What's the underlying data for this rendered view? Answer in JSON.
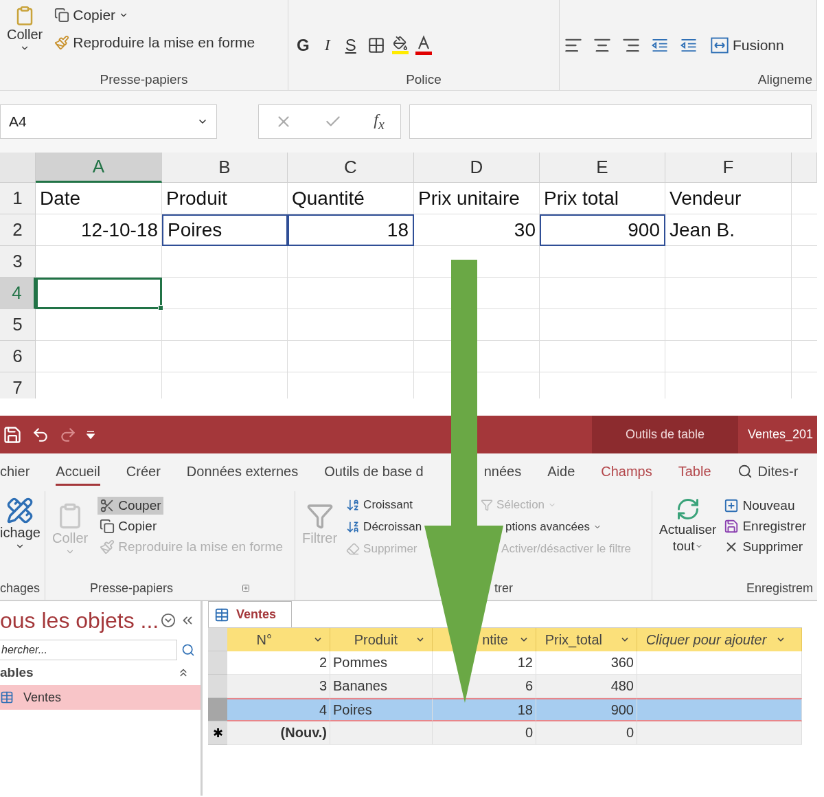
{
  "excel": {
    "ribbon": {
      "clipboard": {
        "label": "Presse-papiers",
        "paste": "Coller",
        "items": [
          {
            "kind": "copy",
            "label": "Copier"
          },
          {
            "kind": "format_painter",
            "label": "Reproduire la mise en forme"
          }
        ]
      },
      "font": {
        "label": "Police",
        "bold": "G",
        "italic": "I",
        "underline": "S"
      },
      "alignment": {
        "label": "Aligneme",
        "merge": "Fusionn"
      }
    },
    "formula_bar": {
      "name_box": "A4",
      "function": "f$_{x}$"
    },
    "columns": [
      "A",
      "B",
      "C",
      "D",
      "E",
      "F"
    ],
    "rows": [
      {
        "number": "1",
        "cells": [
          {
            "text": "Date",
            "kind": "text",
            "selected": false,
            "outlined": false
          },
          {
            "text": "Produit",
            "kind": "text",
            "selected": false,
            "outlined": false
          },
          {
            "text": "Quantité",
            "kind": "text",
            "selected": false,
            "outlined": false
          },
          {
            "text": "Prix unitaire",
            "kind": "text",
            "selected": false,
            "outlined": false
          },
          {
            "text": "Prix total",
            "kind": "text",
            "selected": false,
            "outlined": false
          },
          {
            "text": "Vendeur",
            "kind": "text",
            "selected": false,
            "outlined": false
          }
        ]
      },
      {
        "number": "2",
        "cells": [
          {
            "text": "12-10-18",
            "kind": "number",
            "selected": false,
            "outlined": false
          },
          {
            "text": "Poires",
            "kind": "text",
            "selected": false,
            "outlined": true
          },
          {
            "text": "18",
            "kind": "number",
            "selected": false,
            "outlined": true
          },
          {
            "text": "30",
            "kind": "number",
            "selected": false,
            "outlined": false
          },
          {
            "text": "900",
            "kind": "number",
            "selected": false,
            "outlined": true
          },
          {
            "text": "Jean B.",
            "kind": "text",
            "selected": false,
            "outlined": false
          }
        ]
      },
      {
        "number": "3"
      },
      {
        "number": "4",
        "cells": [
          {
            "selected": true,
            "outlined": false
          }
        ]
      },
      {
        "number": "5"
      },
      {
        "number": "6"
      },
      {
        "number": "7"
      }
    ]
  },
  "access": {
    "title_bar": {
      "context": "Outils de table",
      "document": "Ventes_201"
    },
    "tabs": [
      {
        "label": "chier",
        "kind": "plain",
        "selected": false
      },
      {
        "label": "Accueil",
        "kind": "plain",
        "selected": true
      },
      {
        "label": "Créer",
        "kind": "plain",
        "selected": false
      },
      {
        "label": "Données externes",
        "kind": "plain",
        "selected": false
      },
      {
        "label": "Outils de base d",
        "label_end": "nnées",
        "kind": "plain",
        "selected": false
      },
      {
        "label": "Aide",
        "kind": "plain",
        "selected": false
      },
      {
        "label": "Champs",
        "kind": "context",
        "selected": false
      },
      {
        "label": "Table",
        "kind": "context",
        "selected": false
      },
      {
        "label": "Dites-r",
        "kind": "search",
        "selected": false
      }
    ],
    "ribbon": {
      "view": {
        "label": "chages",
        "button": "ichage"
      },
      "clipboard": {
        "label": "Presse-papiers",
        "paste": {
          "label": "Coller",
          "disabled": true
        },
        "items": [
          {
            "kind": "cut",
            "label": "Couper",
            "disabled": false,
            "highlighted": true
          },
          {
            "kind": "copy",
            "label": "Copier",
            "disabled": false,
            "highlighted": false
          },
          {
            "kind": "format_painter",
            "label": "Reproduire la mise en forme",
            "disabled": true,
            "highlighted": false
          }
        ]
      },
      "sort_filter": {
        "label": "trer",
        "filter": {
          "label": "Filtrer",
          "disabled": true
        },
        "sort_items": [
          {
            "kind": "ascending",
            "label": "Croissant",
            "disabled": false
          },
          {
            "kind": "descending",
            "label": "Décroissan",
            "disabled": false
          },
          {
            "kind": "clear",
            "label": "Supprimer",
            "disabled": true
          }
        ],
        "filter_items": [
          {
            "kind": "selection",
            "label": "Sélection",
            "disabled": true
          },
          {
            "kind": "advanced",
            "label": "ptions avancées",
            "disabled": false
          },
          {
            "kind": "toggle",
            "label": "Activer/désactiver le filtre",
            "disabled": true
          }
        ]
      },
      "records": {
        "label": "Enregistrem",
        "refresh": "Actualiser",
        "refresh_end": "tout",
        "items": [
          {
            "kind": "new",
            "label": "Nouveau"
          },
          {
            "kind": "save",
            "label": "Enregistrer"
          },
          {
            "kind": "delete",
            "label": "Supprimer"
          }
        ]
      }
    },
    "nav_pane": {
      "title": "ous les objets ...",
      "search_placeholder": "hercher...",
      "section": "ables",
      "items": [
        {
          "label": "Ventes",
          "selected": true
        }
      ]
    },
    "datasheet": {
      "tab": "Ventes",
      "columns": [
        {
          "label": "N°",
          "kind": "field"
        },
        {
          "label": "ntite",
          "kind": "partial"
        },
        {
          "label": "Prix_total",
          "kind": "field"
        },
        {
          "label": "Cliquer pour ajouter",
          "kind": "add"
        }
      ],
      "product_column": "Produit",
      "rows": [
        {
          "kind": "record",
          "id": "2",
          "product": "Pommes",
          "quantity": "12",
          "total": "360",
          "selected": false
        },
        {
          "kind": "record",
          "id": "3",
          "product": "Bananes",
          "quantity": "6",
          "total": "480",
          "selected": false
        },
        {
          "kind": "record",
          "id": "4",
          "product": "Poires",
          "quantity": "18",
          "total": "900",
          "selected": true
        },
        {
          "kind": "new",
          "marker": "✱",
          "id": "(Nouv.)",
          "quantity": "0",
          "total": "0",
          "selected": false
        }
      ]
    }
  }
}
